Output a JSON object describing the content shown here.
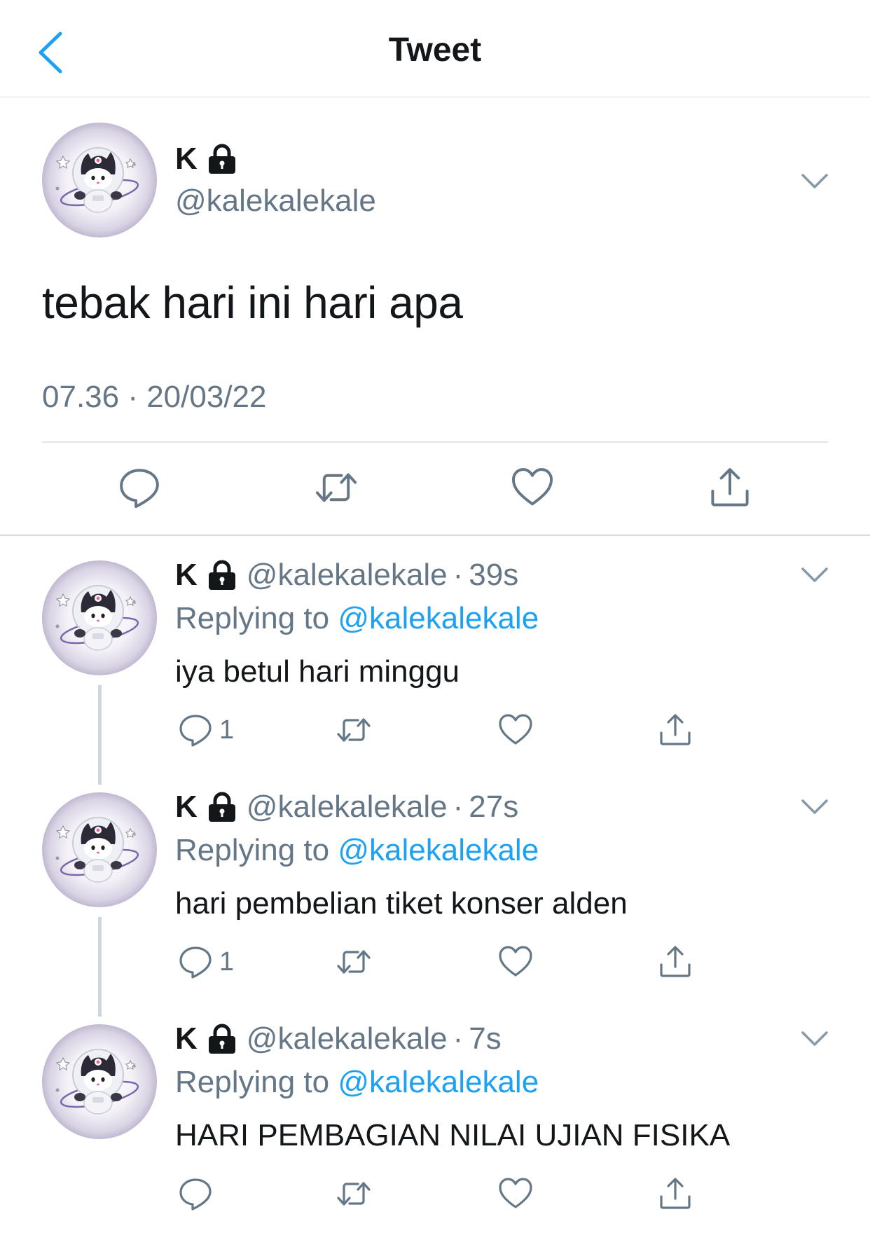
{
  "header": {
    "title": "Tweet",
    "back_icon": "chevron-left-icon",
    "accent": "#1da1f2"
  },
  "main_tweet": {
    "name": "K",
    "handle": "@kalekalekale",
    "text": "tebak hari ini hari apa",
    "timestamp": "07.36 · 20/03/22",
    "actions": [
      "reply-icon",
      "retweet-icon",
      "like-icon",
      "share-icon"
    ]
  },
  "replies": [
    {
      "name": "K",
      "handle": "@kalekalekale",
      "dot": "·",
      "time": "39s",
      "replying_label": "Replying to ",
      "replying_to": "@kalekalekale",
      "text": "iya betul hari minggu",
      "reply_count": "1"
    },
    {
      "name": "K",
      "handle": "@kalekalekale",
      "dot": "·",
      "time": "27s",
      "replying_label": "Replying to ",
      "replying_to": "@kalekalekale",
      "text": "hari pembelian tiket konser alden",
      "reply_count": "1"
    },
    {
      "name": "K",
      "handle": "@kalekalekale",
      "dot": "·",
      "time": "7s",
      "replying_label": "Replying to ",
      "replying_to": "@kalekalekale",
      "text": "HARI PEMBAGIAN NILAI UJIAN FISIKA",
      "reply_count": ""
    }
  ],
  "colors": {
    "text": "#14171a",
    "secondary": "#657786",
    "divider": "#d8dde2",
    "link": "#1da1f2"
  }
}
